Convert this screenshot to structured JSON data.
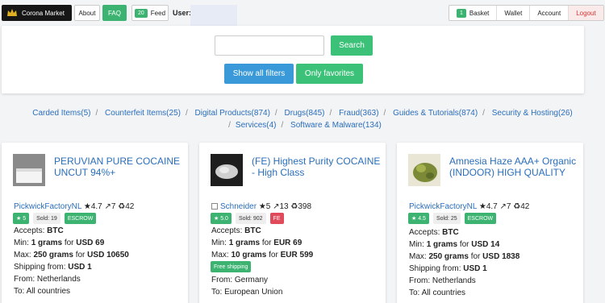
{
  "nav": {
    "brand": "Corona Market",
    "about": "About",
    "faq": "FAQ",
    "feed_count": "20",
    "feed": "Feed",
    "user_label": "User:",
    "basket_count": "1",
    "basket": "Basket",
    "wallet": "Wallet",
    "account": "Account",
    "logout": "Logout"
  },
  "search": {
    "placeholder": "",
    "search_label": "Search",
    "filters_label": "Show all filters",
    "favorites_label": "Only favorites"
  },
  "categories": [
    "Carded Items(5)",
    "Counterfeit Items(25)",
    "Digital Products(874)",
    "Drugs(845)",
    "Fraud(363)",
    "Guides & Tutorials(874)",
    "Security & Hosting(26)",
    "Services(4)",
    "Software & Malware(134)"
  ],
  "listings": [
    {
      "title": "PERUVIAN PURE COCAINE UNCUT 94%+",
      "vendor": "PickwickFactoryNL",
      "vendor_stats": "★4.7 ↗7 ♻42",
      "rating_badge": "★ 5",
      "sold": "Sold: 19",
      "badge3": "ESCROW",
      "accepts_label": "Accepts:",
      "accepts": "BTC",
      "min_label": "Min:",
      "min_qty": "1 grams",
      "min_for": "for",
      "min_price": "USD 69",
      "max_label": "Max:",
      "max_qty": "250 grams",
      "max_for": "for",
      "max_price": "USD 10650",
      "ship_label": "Shipping from:",
      "ship": "USD 1",
      "from": "From: Netherlands",
      "to": "To: All countries"
    },
    {
      "title": "(FE) Highest Purity COCAINE - High Class",
      "vendor": "Schneider",
      "vendor_stats": "★5 ↗13 ♻398",
      "rating_badge": "★ 5.0",
      "sold": "Sold: 902",
      "badge3": "FE",
      "accepts_label": "Accepts:",
      "accepts": "BTC",
      "min_label": "Min:",
      "min_qty": "1 grams",
      "min_for": "for",
      "min_price": "EUR 69",
      "max_label": "Max:",
      "max_qty": "10 grams",
      "max_for": "for",
      "max_price": "EUR 599",
      "free_shipping": "Free shipping",
      "from": "From: Germany",
      "to": "To: European Union"
    },
    {
      "title": "Amnesia Haze AAA+ Organic (INDOOR) HIGH QUALITY",
      "vendor": "PickwickFactoryNL",
      "vendor_stats": "★4.7 ↗7 ♻42",
      "rating_badge": "★ 4.5",
      "sold": "Sold: 25",
      "badge3": "ESCROW",
      "accepts_label": "Accepts:",
      "accepts": "BTC",
      "min_label": "Min:",
      "min_qty": "1 grams",
      "min_for": "for",
      "min_price": "USD 14",
      "max_label": "Max:",
      "max_qty": "250 grams",
      "max_for": "for",
      "max_price": "USD 1838",
      "ship_label": "Shipping from:",
      "ship": "USD 1",
      "from": "From: Netherlands",
      "to": "To: All countries"
    }
  ],
  "colors": {
    "green": "#3cb371",
    "blue": "#3a9ad9",
    "link": "#2a6ebb",
    "red": "#e04a5a"
  }
}
